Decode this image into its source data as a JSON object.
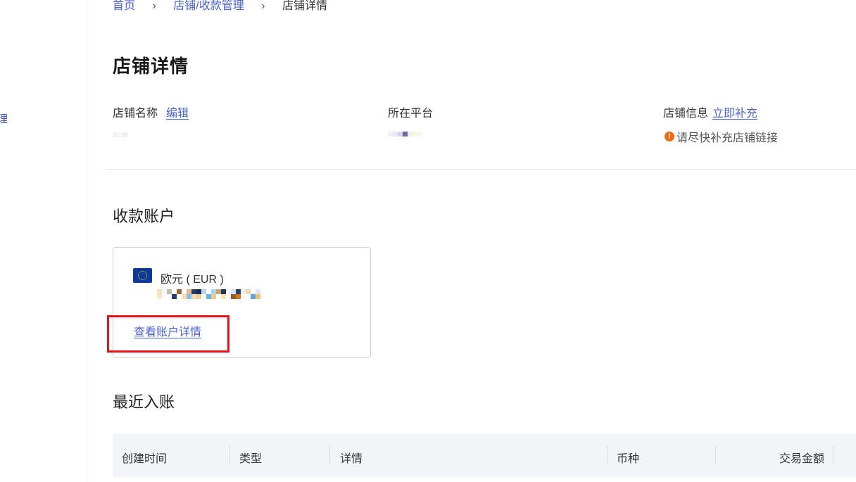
{
  "sidebar": {
    "partial_item_label": "理"
  },
  "breadcrumb": {
    "home": "首页",
    "parent": "店铺/收款管理",
    "current": "店铺详情",
    "separator": "›"
  },
  "page": {
    "title": "店铺详情"
  },
  "store_info": {
    "name_label": "店铺名称",
    "edit_link": "编辑",
    "platform_label": "所在平台",
    "info_label": "店铺信息",
    "supplement_link": "立即补充",
    "warning_text": "请尽快补充店铺链接",
    "warning_icon": "exclamation-icon",
    "warning_color": "#f06a0f"
  },
  "accounts": {
    "section_title": "收款账户",
    "cards": [
      {
        "currency_label": "欧元 ( EUR )",
        "flag_icon": "eu-flag-icon",
        "details_link": "查看账户详情"
      }
    ]
  },
  "recent": {
    "section_title": "最近入账",
    "columns": [
      "创建时间",
      "类型",
      "详情",
      "币种",
      "交易金额"
    ]
  },
  "colors": {
    "link": "#4a62cc",
    "highlight_box": "#e8121a",
    "table_header_bg": "#f3f4f8"
  }
}
